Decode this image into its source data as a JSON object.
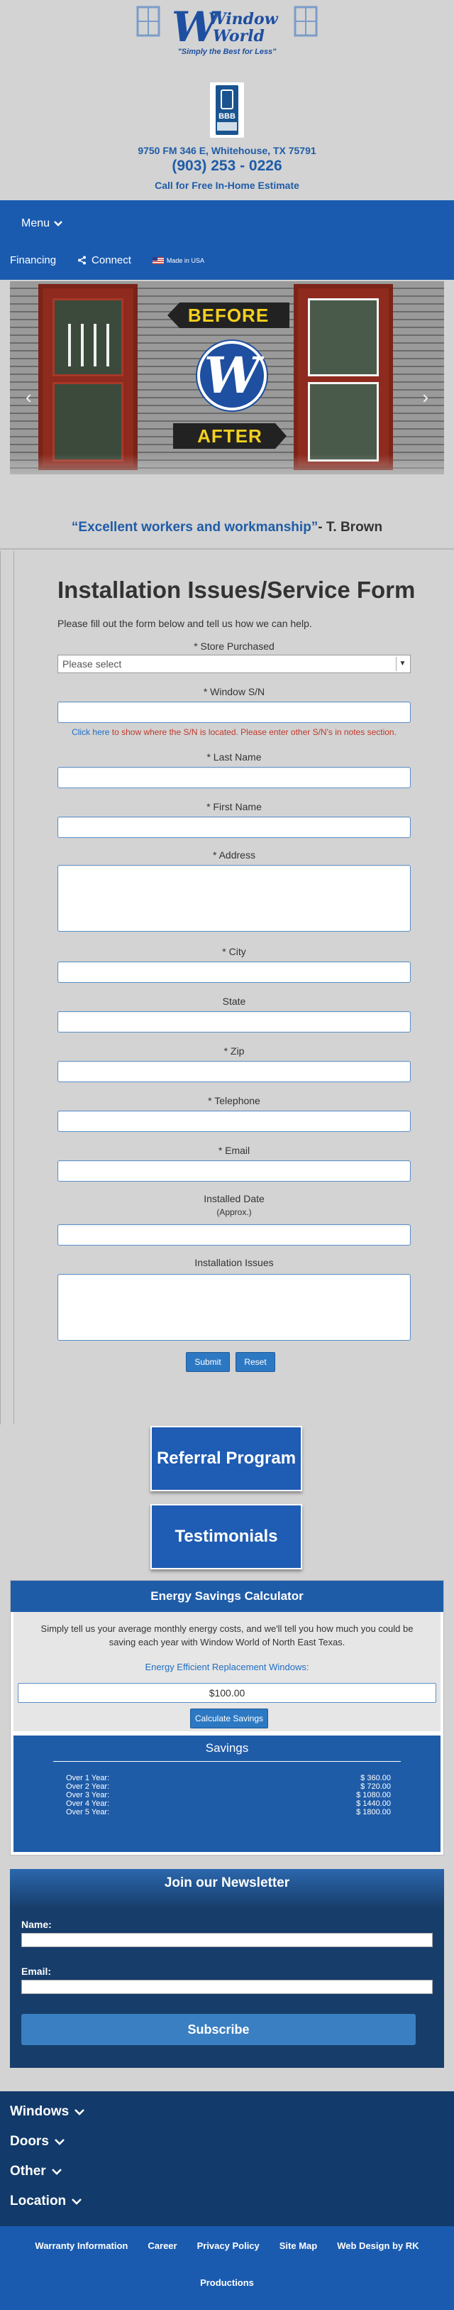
{
  "header": {
    "logo_word1": "Window",
    "logo_word2": "World",
    "logo_tagline": "\"Simply the Best for Less\"",
    "bbb_text": "BBB",
    "address": "9750 FM 346 E, Whitehouse, TX 75791",
    "phone": "(903) 253 - 0226",
    "cta": "Call for Free In-Home Estimate"
  },
  "nav": {
    "menu_label": "Menu",
    "financing": "Financing",
    "connect": "Connect",
    "made_in_usa": "Made in USA"
  },
  "slider": {
    "before_label": "BEFORE",
    "after_label": "AFTER",
    "logo_letter": "W"
  },
  "testimonial": {
    "quote": "“Excellent workers and workmanship”",
    "author": "- T. Brown"
  },
  "form": {
    "title": "Installation Issues/Service Form",
    "intro": "Please fill out the form below and tell us how we can help.",
    "store_label": "* Store Purchased",
    "store_value": "Please select",
    "serial_label": "* Window S/N",
    "serial_note_link": "Click here",
    "serial_note_rest": " to show where the S/N is located. Please enter other S/N's in notes section.",
    "last_name_label": "* Last Name",
    "first_name_label": "* First Name",
    "address_label": "* Address",
    "city_label": "* City",
    "state_label": "State",
    "zip_label": "* Zip",
    "telephone_label": "* Telephone",
    "email_label": "* Email",
    "installed_date_label": "Installed Date",
    "installed_date_sub": "(Approx.)",
    "issues_label": "Installation Issues",
    "submit_label": "Submit",
    "reset_label": "Reset"
  },
  "promo": {
    "referral_label": "Referral Program",
    "testimonials_label": "Testimonials"
  },
  "calculator": {
    "title": "Energy Savings Calculator",
    "description": "Simply tell us your average monthly energy costs, and we'll tell you how much you could be saving each year with Window World of North East Texas.",
    "input_label": "Energy Efficient Replacement Windows:",
    "input_value": "$100.00",
    "button_label": "Calculate Savings",
    "savings_title": "Savings",
    "rows": [
      {
        "period": "Over 1 Year:",
        "amount": "$ 360.00"
      },
      {
        "period": "Over 2 Year:",
        "amount": "$ 720.00"
      },
      {
        "period": "Over 3 Year:",
        "amount": "$ 1080.00"
      },
      {
        "period": "Over 4 Year:",
        "amount": "$ 1440.00"
      },
      {
        "period": "Over 5 Year:",
        "amount": "$ 1800.00"
      }
    ]
  },
  "newsletter": {
    "title": "Join our Newsletter",
    "name_label": "Name:",
    "email_label": "Email:",
    "subscribe_label": "Subscribe"
  },
  "footer": {
    "nav": [
      "Windows",
      "Doors",
      "Other",
      "Location"
    ],
    "links": [
      "Warranty Information",
      "Career",
      "Privacy Policy",
      "Site Map",
      "Web Design by RK"
    ],
    "credit": "Productions"
  },
  "colors": {
    "brand_blue": "#1a5bb0",
    "text_blue": "#1f5ca8",
    "footer_navy": "#123a6a"
  }
}
